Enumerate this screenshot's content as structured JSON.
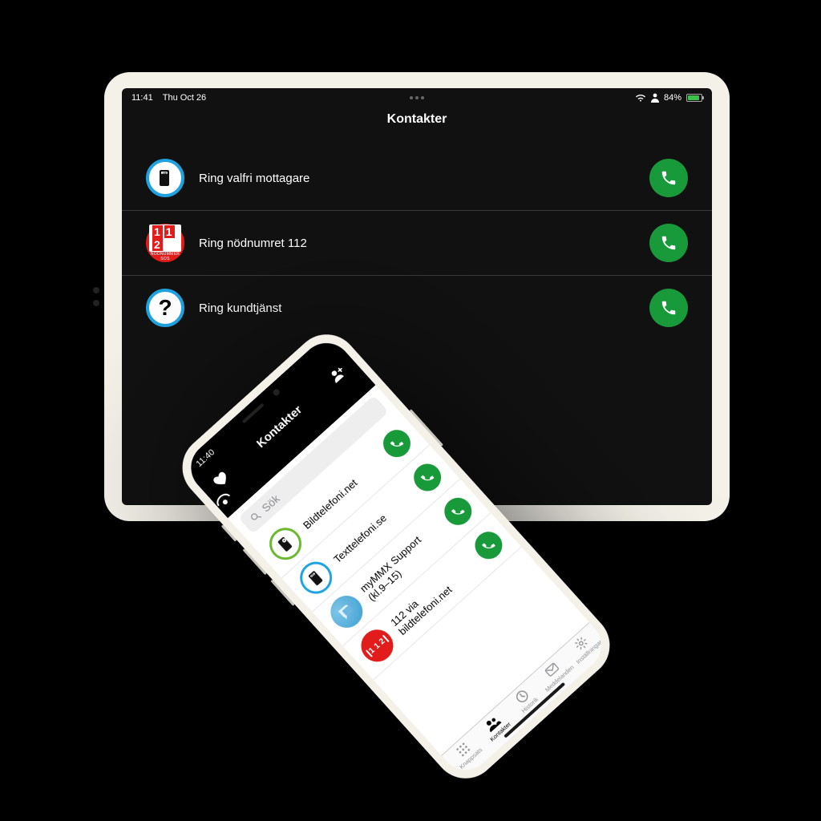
{
  "tablet": {
    "status": {
      "time": "11:41",
      "date": "Thu Oct 26",
      "battery_pct": "84%"
    },
    "title": "Kontakter",
    "rows": [
      {
        "label": "Ring valfri mottagare"
      },
      {
        "label": "Ring nödnumret 112"
      },
      {
        "label": "Ring kundtjänst"
      }
    ]
  },
  "phone": {
    "status": {
      "time": "11:40"
    },
    "title": "Kontakter",
    "search_placeholder": "Sök",
    "rows": [
      {
        "label": "Bildtelefoni.net"
      },
      {
        "label": "Texttelefoni.se"
      },
      {
        "label": "myMMX Support (kl.9–15)"
      },
      {
        "label": "112 via bildtelefoni.net"
      }
    ],
    "tabs": [
      {
        "label": "Knappsats"
      },
      {
        "label": "Kontakter"
      },
      {
        "label": "Historik"
      },
      {
        "label": "Meddelanden"
      },
      {
        "label": "Inställningar"
      }
    ]
  },
  "colors": {
    "call_green": "#189a3b",
    "ring_blue": "#1ea3e0",
    "emergency_red": "#e21b1b"
  }
}
